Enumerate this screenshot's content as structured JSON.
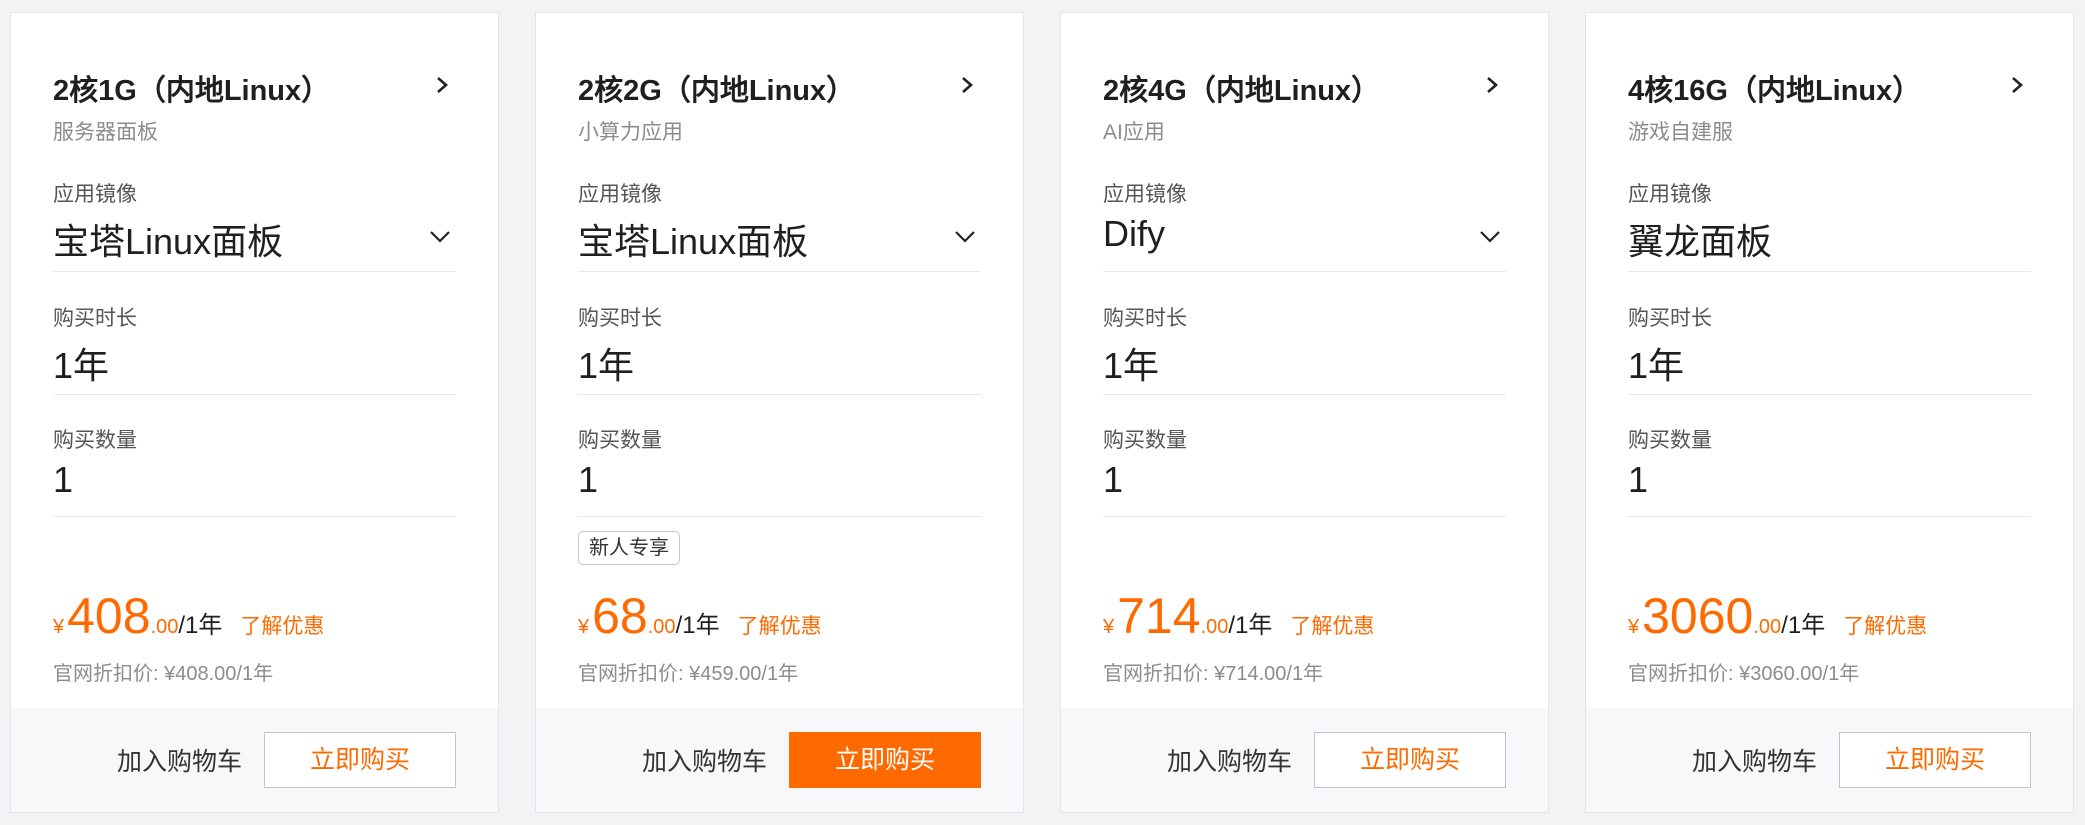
{
  "labels": {
    "image": "应用镜像",
    "duration": "购买时长",
    "quantity": "购买数量",
    "learn_more": "了解优惠",
    "list_price_prefix": "官网折扣价: ",
    "add_to_cart": "加入购物车",
    "buy_now": "立即购买",
    "currency": "¥"
  },
  "colors": {
    "accent": "#ff6a00",
    "muted": "#8c8c8c"
  },
  "cards": [
    {
      "title": "2核1G（内地Linux）",
      "subtitle": "服务器面板",
      "image_value": "宝塔Linux面板",
      "has_dropdown": true,
      "duration_value": "1年",
      "quantity_value": "1",
      "promo_tag": "",
      "price_int": "408",
      "price_dec": ".00",
      "price_unit": "/1年",
      "list_price": "官网折扣价: ¥408.00/1年",
      "buy_primary": false
    },
    {
      "title": "2核2G（内地Linux）",
      "subtitle": "小算力应用",
      "image_value": "宝塔Linux面板",
      "has_dropdown": true,
      "duration_value": "1年",
      "quantity_value": "1",
      "promo_tag": "新人专享",
      "price_int": "68",
      "price_dec": ".00",
      "price_unit": "/1年",
      "list_price": "官网折扣价: ¥459.00/1年",
      "buy_primary": true
    },
    {
      "title": "2核4G（内地Linux）",
      "subtitle": "AI应用",
      "image_value": "Dify",
      "has_dropdown": true,
      "duration_value": "1年",
      "quantity_value": "1",
      "promo_tag": "",
      "price_int": "714",
      "price_dec": ".00",
      "price_unit": "/1年",
      "list_price": "官网折扣价: ¥714.00/1年",
      "buy_primary": false
    },
    {
      "title": "4核16G（内地Linux）",
      "subtitle": "游戏自建服",
      "image_value": "翼龙面板",
      "has_dropdown": false,
      "duration_value": "1年",
      "quantity_value": "1",
      "promo_tag": "",
      "price_int": "3060",
      "price_dec": ".00",
      "price_unit": "/1年",
      "list_price": "官网折扣价: ¥3060.00/1年",
      "buy_primary": false
    }
  ]
}
